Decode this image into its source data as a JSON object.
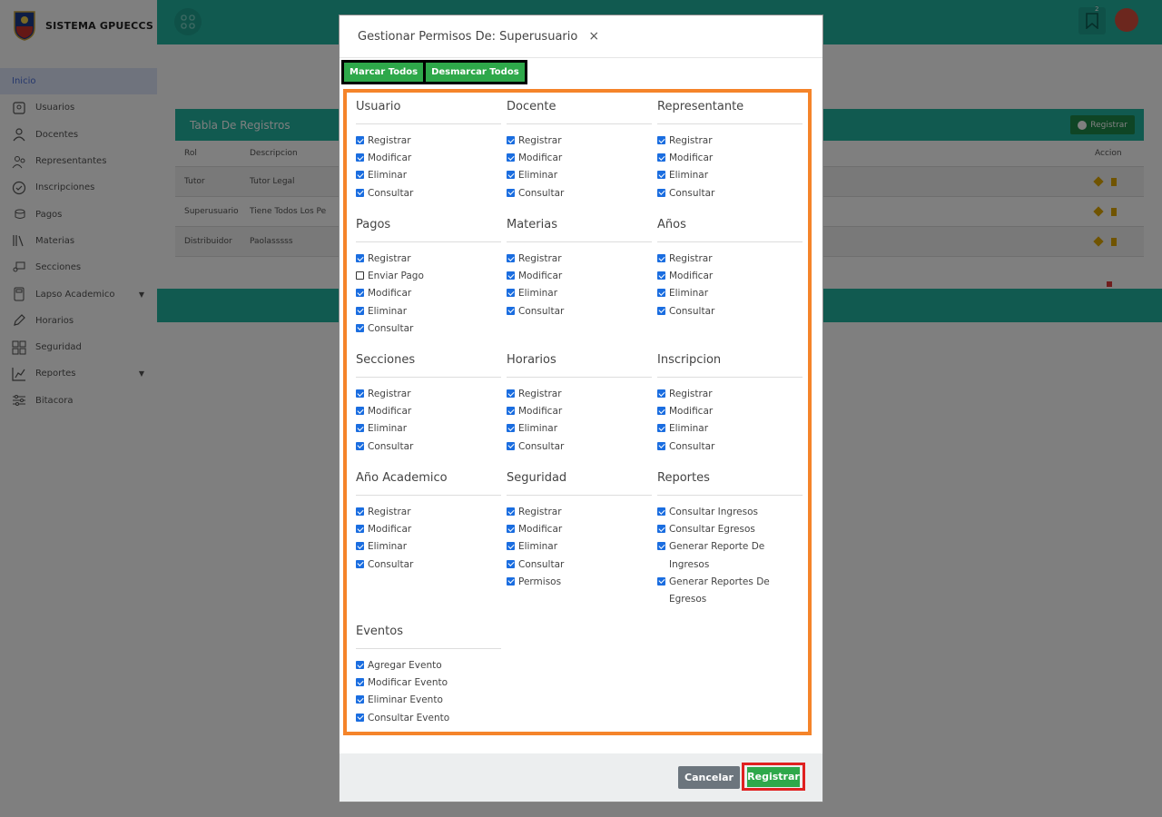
{
  "app": {
    "title": "SISTEMA GPUECCS"
  },
  "sidebar": {
    "items": [
      {
        "label": "Inicio",
        "icon": "home-icon"
      },
      {
        "label": "Usuarios",
        "icon": "users-icon"
      },
      {
        "label": "Docentes",
        "icon": "teacher-icon"
      },
      {
        "label": "Representantes",
        "icon": "guardians-icon"
      },
      {
        "label": "Inscripciones",
        "icon": "check-circle-icon"
      },
      {
        "label": "Pagos",
        "icon": "coins-icon"
      },
      {
        "label": "Materias",
        "icon": "books-icon"
      },
      {
        "label": "Secciones",
        "icon": "classroom-icon"
      },
      {
        "label": "Lapso Academico",
        "icon": "calculator-icon"
      },
      {
        "label": "Horarios",
        "icon": "edit-icon"
      },
      {
        "label": "Seguridad",
        "icon": "dashboard-icon"
      },
      {
        "label": "Reportes",
        "icon": "chart-icon"
      },
      {
        "label": "Bitacora",
        "icon": "sliders-icon"
      }
    ]
  },
  "header": {
    "notification_count": "2"
  },
  "table": {
    "title": "Tabla De Registros",
    "register_label": "Registrar",
    "columns": [
      "Rol",
      "Descripcion",
      "Accion"
    ],
    "rows": [
      [
        "Tutor",
        "Tutor Legal"
      ],
      [
        "Superusuario",
        "Tiene Todos Los Pe"
      ],
      [
        "Distribuidor",
        "Paolasssss"
      ]
    ]
  },
  "modal": {
    "title": "Gestionar Permisos De: Superusuario",
    "close": "×",
    "check_all": "Marcar Todos",
    "uncheck_all": "Desmarcar Todos",
    "cancel": "Cancelar",
    "submit": "Registrar",
    "groups": [
      {
        "title": "Usuario",
        "perms": [
          [
            "Registrar",
            true
          ],
          [
            "Modificar",
            true
          ],
          [
            "Eliminar",
            true
          ],
          [
            "Consultar",
            true
          ]
        ]
      },
      {
        "title": "Docente",
        "perms": [
          [
            "Registrar",
            true
          ],
          [
            "Modificar",
            true
          ],
          [
            "Eliminar",
            true
          ],
          [
            "Consultar",
            true
          ]
        ]
      },
      {
        "title": "Representante",
        "perms": [
          [
            "Registrar",
            true
          ],
          [
            "Modificar",
            true
          ],
          [
            "Eliminar",
            true
          ],
          [
            "Consultar",
            true
          ]
        ]
      },
      {
        "title": "Pagos",
        "perms": [
          [
            "Registrar",
            true
          ],
          [
            "Enviar Pago",
            false
          ],
          [
            "Modificar",
            true
          ],
          [
            "Eliminar",
            true
          ],
          [
            "Consultar",
            true
          ]
        ]
      },
      {
        "title": "Materias",
        "perms": [
          [
            "Registrar",
            true
          ],
          [
            "Modificar",
            true
          ],
          [
            "Eliminar",
            true
          ],
          [
            "Consultar",
            true
          ]
        ]
      },
      {
        "title": "Años",
        "perms": [
          [
            "Registrar",
            true
          ],
          [
            "Modificar",
            true
          ],
          [
            "Eliminar",
            true
          ],
          [
            "Consultar",
            true
          ]
        ]
      },
      {
        "title": "Secciones",
        "perms": [
          [
            "Registrar",
            true
          ],
          [
            "Modificar",
            true
          ],
          [
            "Eliminar",
            true
          ],
          [
            "Consultar",
            true
          ]
        ]
      },
      {
        "title": "Horarios",
        "perms": [
          [
            "Registrar",
            true
          ],
          [
            "Modificar",
            true
          ],
          [
            "Eliminar",
            true
          ],
          [
            "Consultar",
            true
          ]
        ]
      },
      {
        "title": "Inscripcion",
        "perms": [
          [
            "Registrar",
            true
          ],
          [
            "Modificar",
            true
          ],
          [
            "Eliminar",
            true
          ],
          [
            "Consultar",
            true
          ]
        ]
      },
      {
        "title": "Año Academico",
        "perms": [
          [
            "Registrar",
            true
          ],
          [
            "Modificar",
            true
          ],
          [
            "Eliminar",
            true
          ],
          [
            "Consultar",
            true
          ]
        ]
      },
      {
        "title": "Seguridad",
        "perms": [
          [
            "Registrar",
            true
          ],
          [
            "Modificar",
            true
          ],
          [
            "Eliminar",
            true
          ],
          [
            "Consultar",
            true
          ],
          [
            "Permisos",
            true
          ]
        ]
      },
      {
        "title": "Reportes",
        "perms": [
          [
            "Consultar Ingresos",
            true
          ],
          [
            "Consultar Egresos",
            true
          ],
          [
            "Generar Reporte De Ingresos",
            true
          ],
          [
            "Generar Reportes De Egresos",
            true
          ]
        ]
      },
      {
        "title": "Eventos",
        "perms": [
          [
            "Agregar Evento",
            true
          ],
          [
            "Modificar Evento",
            true
          ],
          [
            "Eliminar Evento",
            true
          ],
          [
            "Consultar Evento",
            true
          ]
        ]
      }
    ]
  },
  "colors": {
    "primary": "#22b4a0",
    "success": "#2ea84a",
    "highlight": "#f5842a"
  }
}
